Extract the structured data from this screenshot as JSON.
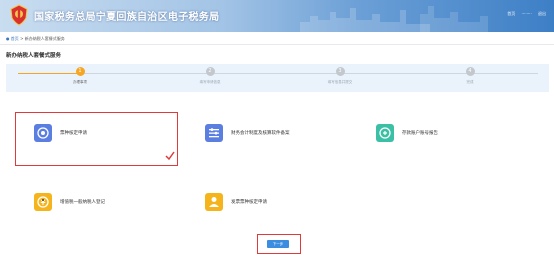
{
  "header": {
    "site_title": "国家税务总局宁夏回族自治区电子税务局",
    "user_links": [
      "首页",
      "········",
      "退出"
    ]
  },
  "breadcrumb": {
    "home": "首页",
    "separator": ">",
    "current": "新办纳税人套餐式服务"
  },
  "page_title": "新办纳税人套餐式服务",
  "steps": [
    {
      "number": "1",
      "label": "办理事项",
      "state": "active"
    },
    {
      "number": "2",
      "label": "填写申请信息",
      "state": "pending"
    },
    {
      "number": "3",
      "label": "填写信息并提交",
      "state": "pending"
    },
    {
      "number": "4",
      "label": "完成",
      "state": "pending"
    }
  ],
  "cards": [
    {
      "label": "票种核定申请",
      "icon": "invoice-icon",
      "color": "#5b7fe0",
      "selected": true
    },
    {
      "label": "财务会计制度及核算软件备案",
      "icon": "settings-icon",
      "color": "#5b7fe0",
      "selected": false
    },
    {
      "label": "存款账户账号报告",
      "icon": "bank-account-icon",
      "color": "#3cc0a5",
      "selected": false
    },
    {
      "label": "增值税一般纳税人登记",
      "icon": "vat-icon",
      "color": "#f5b41c",
      "selected": false
    },
    {
      "label": "发票票种核定申请",
      "icon": "person-icon",
      "color": "#f5b41c",
      "selected": false
    }
  ],
  "next_button": "下一步",
  "colors": {
    "accent": "#3b8de0",
    "active_step": "#f6a623",
    "highlight": "#e03b3b"
  }
}
